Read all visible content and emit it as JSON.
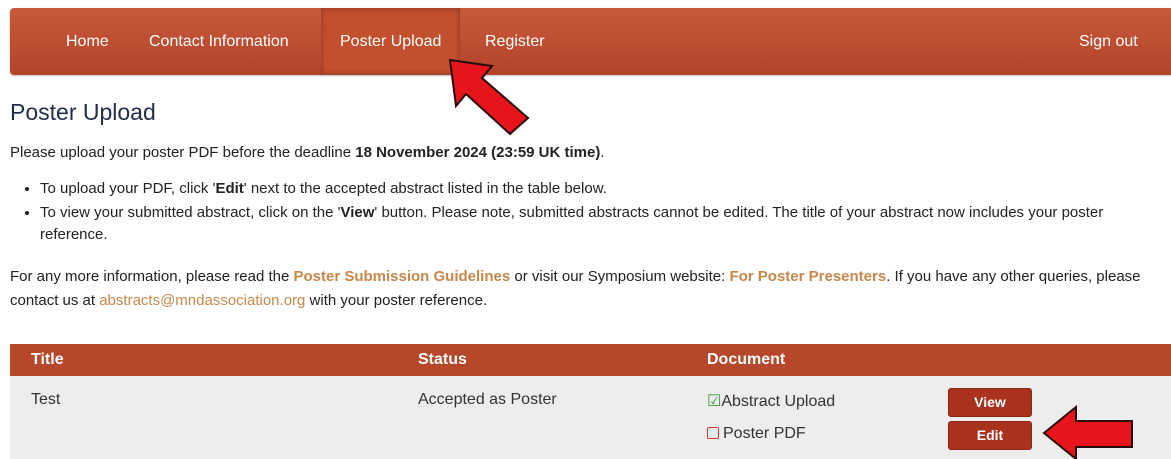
{
  "nav": {
    "items": [
      "Home",
      "Contact Information",
      "Poster Upload",
      "Register"
    ],
    "active_index": 2,
    "sign_out": "Sign out"
  },
  "page": {
    "title": "Poster Upload",
    "intro_prefix": "Please upload your poster PDF before the deadline ",
    "intro_deadline": "18 November 2024 (23:59 UK time)",
    "intro_suffix": ".",
    "bullet1_prefix": "To upload your PDF, click '",
    "bullet1_bold": "Edit",
    "bullet1_suffix": "' next to the accepted abstract listed in the table below.",
    "bullet2_prefix": "To view your submitted abstract, click on the '",
    "bullet2_bold": "View",
    "bullet2_suffix": "' button. Please note, submitted abstracts cannot be edited. The title of your abstract now includes your poster reference.",
    "more_prefix": "For any more information, please read the ",
    "more_link1": "Poster Submission Guidelines",
    "more_middle": " or visit our Symposium website: ",
    "more_link2": "For Poster Presenters",
    "more_middle2": ". If you have any other queries, please contact us at ",
    "more_email": "abstracts@mndassociation.org",
    "more_suffix": " with your poster reference."
  },
  "table": {
    "headers": [
      "Title",
      "Status",
      "Document"
    ],
    "row": {
      "title": "Test",
      "status": "Accepted as Poster",
      "doc1": "Abstract Upload",
      "doc2": "Poster PDF",
      "view_label": "View",
      "edit_label": "Edit"
    }
  },
  "colors": {
    "nav": "#b7472a",
    "link": "#c8874a",
    "button": "#a8321e",
    "annotation_arrow": "#e8141b"
  },
  "icons": [
    "check-square-icon",
    "empty-checkbox-icon",
    "red-arrow-annotation"
  ]
}
